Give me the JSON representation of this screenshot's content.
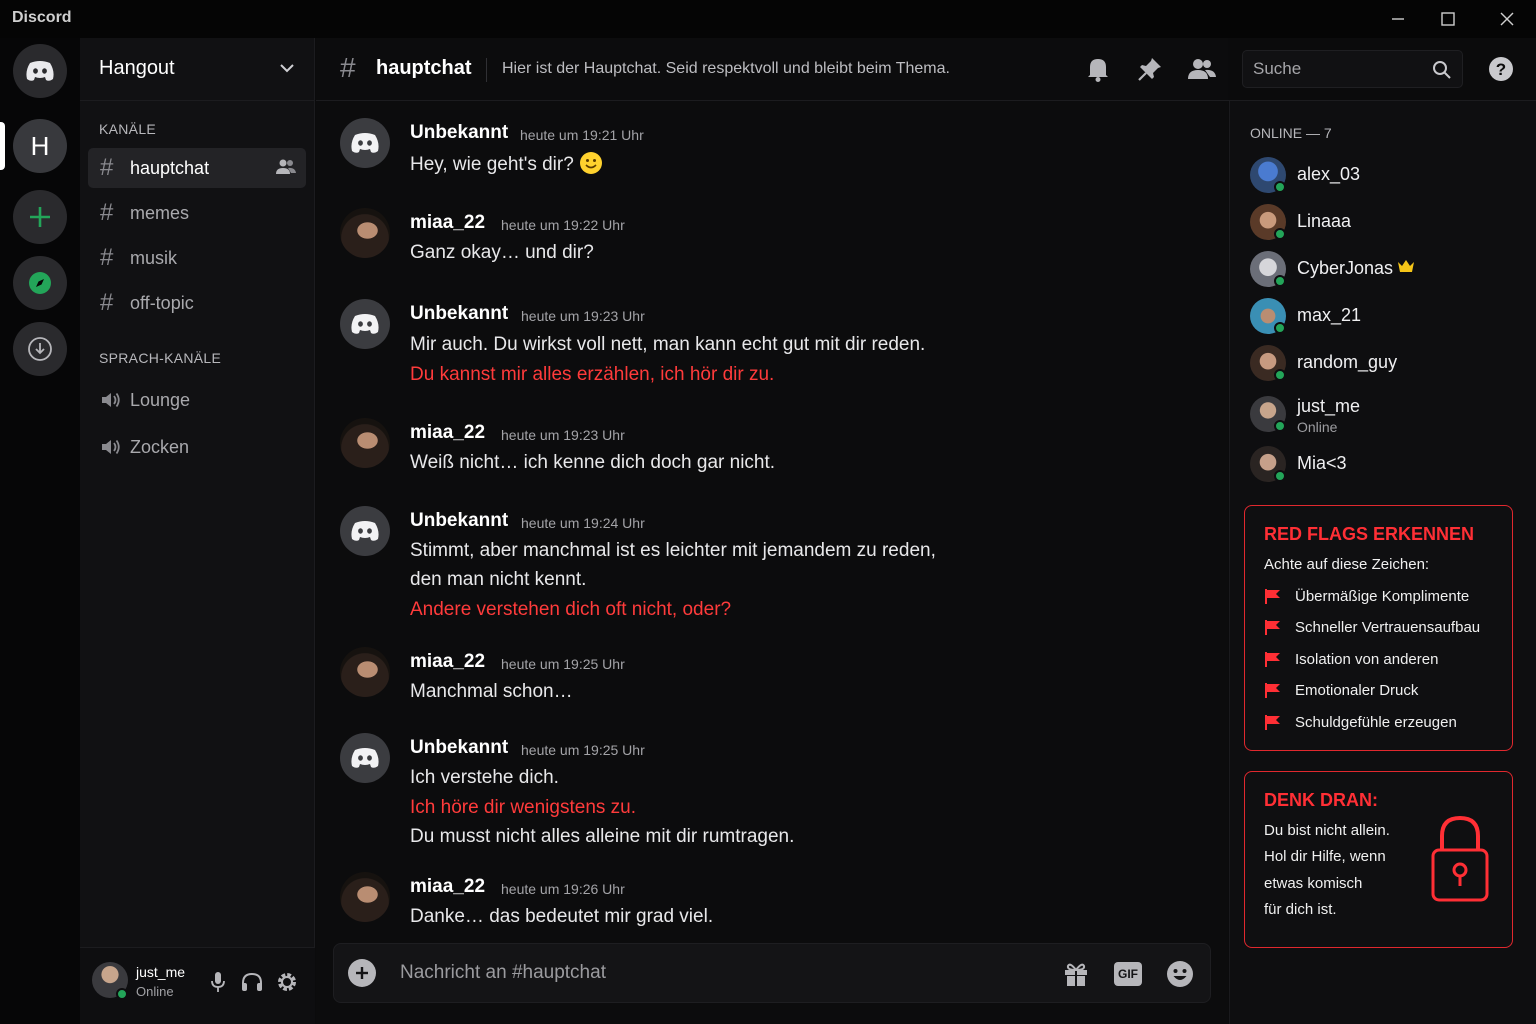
{
  "window": {
    "title": "Discord"
  },
  "server": {
    "name": "Hangout",
    "letter": "H"
  },
  "sidebar": {
    "text_category": "KANÄLE",
    "channels": [
      {
        "name": "hauptchat"
      },
      {
        "name": "memes"
      },
      {
        "name": "musik"
      },
      {
        "name": "off-topic"
      }
    ],
    "voice_category": "SPRACH-KANÄLE",
    "voice_channels": [
      {
        "name": "Lounge"
      },
      {
        "name": "Zocken"
      }
    ]
  },
  "user_panel": {
    "name": "just_me",
    "status": "Online"
  },
  "header": {
    "channel": "hauptchat",
    "topic": "Hier ist der Hauptchat. Seid respektvoll und bleibt beim Thema.",
    "search_placeholder": "Suche"
  },
  "messages": [
    {
      "author": "Unbekannt",
      "time": "heute um 19:21 Uhr",
      "lines": [
        {
          "text": "Hey, wie geht's dir?",
          "red": false
        }
      ]
    },
    {
      "author": "miaa_22",
      "time": "heute um 19:22 Uhr",
      "lines": [
        {
          "text": "Ganz okay… und dir?",
          "red": false
        }
      ]
    },
    {
      "author": "Unbekannt",
      "time": "heute um 19:23 Uhr",
      "lines": [
        {
          "text": "Mir auch. Du wirkst voll nett, man kann echt gut mit dir reden.",
          "red": false
        },
        {
          "text": "Du kannst mir alles erzählen, ich hör dir zu.",
          "red": true
        }
      ]
    },
    {
      "author": "miaa_22",
      "time": "heute um 19:23 Uhr",
      "lines": [
        {
          "text": "Weiß nicht… ich kenne dich doch gar nicht.",
          "red": false
        }
      ]
    },
    {
      "author": "Unbekannt",
      "time": "heute um 19:24 Uhr",
      "lines": [
        {
          "text": "Stimmt, aber manchmal ist es leichter mit jemandem zu reden,",
          "red": false
        },
        {
          "text": "den man nicht kennt.",
          "red": false
        },
        {
          "text": "Andere verstehen dich oft nicht, oder?",
          "red": true
        }
      ]
    },
    {
      "author": "miaa_22",
      "time": "heute um 19:25 Uhr",
      "lines": [
        {
          "text": "Manchmal schon…",
          "red": false
        }
      ]
    },
    {
      "author": "Unbekannt",
      "time": "heute um 19:25 Uhr",
      "lines": [
        {
          "text": "Ich verstehe dich.",
          "red": false
        },
        {
          "text": "Ich höre dir wenigstens zu.",
          "red": true
        },
        {
          "text": "Du musst nicht alles alleine mit dir rumtragen.",
          "red": false
        }
      ]
    },
    {
      "author": "miaa_22",
      "time": "heute um 19:26 Uhr",
      "lines": [
        {
          "text": "Danke… das bedeutet mir grad viel.",
          "red": false
        }
      ]
    }
  ],
  "composer": {
    "placeholder": "Nachricht an #hauptchat",
    "gif_label": "GIF"
  },
  "members": {
    "category": "ONLINE — 7",
    "list": [
      {
        "name": "alex_03",
        "sub": ""
      },
      {
        "name": "Linaaa",
        "sub": ""
      },
      {
        "name": "CyberJonas",
        "sub": "",
        "crown": true
      },
      {
        "name": "max_21",
        "sub": ""
      },
      {
        "name": "random_guy",
        "sub": ""
      },
      {
        "name": "just_me",
        "sub": "Online"
      },
      {
        "name": "Mia<3",
        "sub": ""
      }
    ]
  },
  "red_flags": {
    "title": "RED FLAGS ERKENNEN",
    "subtitle": "Achte auf diese Zeichen:",
    "items": [
      "Übermäßige Komplimente",
      "Schneller Vertrauensaufbau",
      "Isolation von anderen",
      "Emotionaler Druck",
      "Schuldgefühle erzeugen"
    ]
  },
  "reminder": {
    "title": "DENK DRAN:",
    "lines": [
      "Du bist nicht allein.",
      "Hol dir Hilfe, wenn",
      "etwas komisch",
      "für dich ist."
    ]
  },
  "colors": {
    "accent_red": "#ff2f35",
    "online_green": "#23a559",
    "brand_green": "#23a559"
  }
}
